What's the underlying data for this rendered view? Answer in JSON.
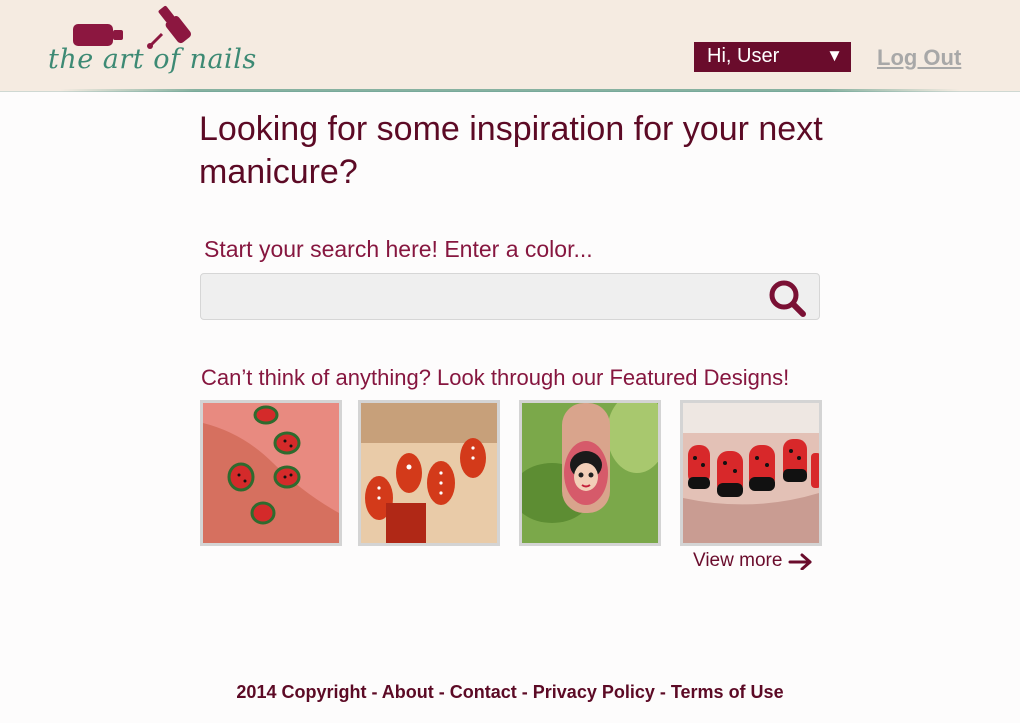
{
  "header": {
    "logo_text": "the art of nails",
    "user_menu_label": "Hi, User",
    "logout_label": "Log Out",
    "colors": {
      "header_bg": "#f5ebe1",
      "brand_teal": "#3d8a74",
      "brand_maroon": "#6a0c2c"
    }
  },
  "main": {
    "headline": "Looking for some inspiration for your next manicure?",
    "search_label": "Start your search here! Enter a color...",
    "search_value": "",
    "search_icon": "search-icon",
    "featured_label": "Can’t think of anything? Look through our Featured Designs!",
    "featured_designs": [
      {
        "name": "watermelon nails"
      },
      {
        "name": "red polka dot nails"
      },
      {
        "name": "snow white nail art"
      },
      {
        "name": "ladybug nails"
      }
    ],
    "view_more_label": "View more"
  },
  "footer": {
    "copyright": "2014 Copyright",
    "separator": " - ",
    "links": [
      "About",
      "Contact",
      "Privacy Policy",
      "Terms of Use"
    ]
  }
}
